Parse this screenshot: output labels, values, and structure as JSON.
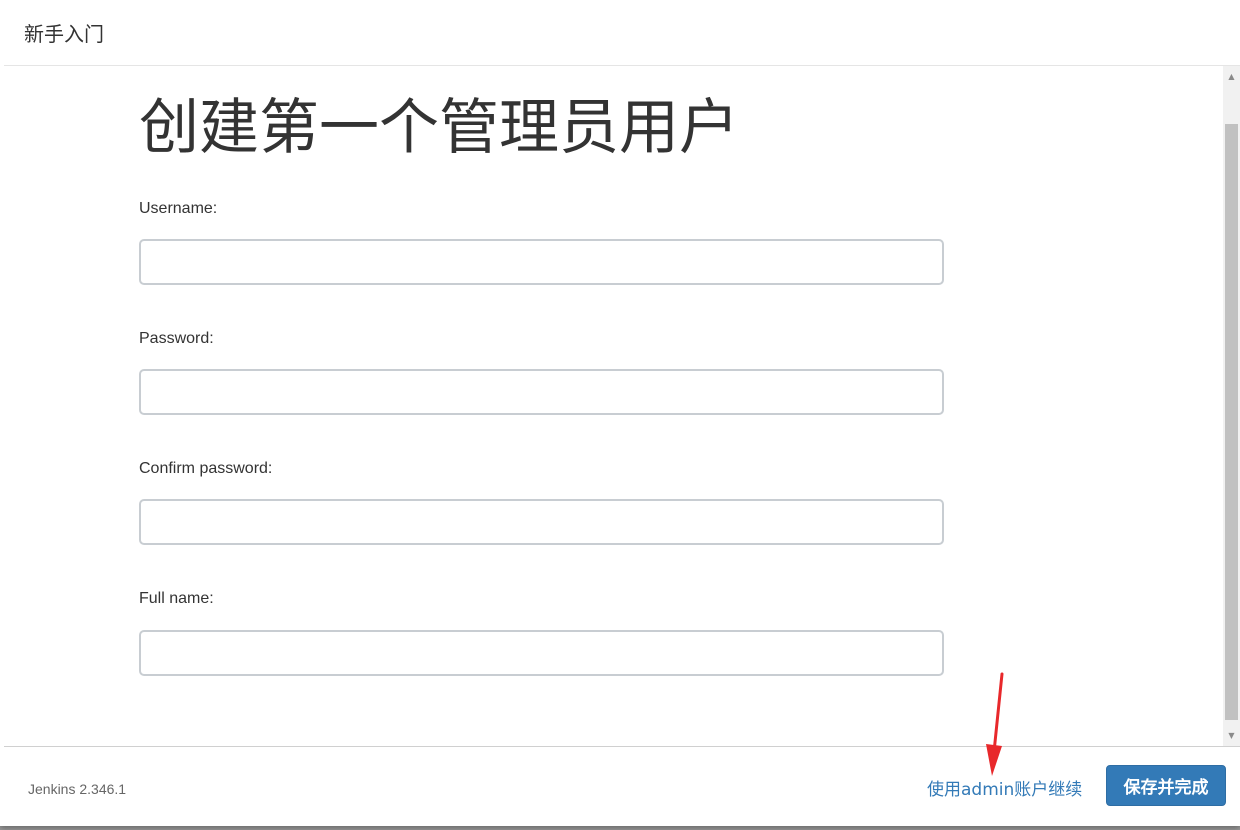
{
  "header": {
    "title": "新手入门"
  },
  "main": {
    "title": "创建第一个管理员用户",
    "fields": [
      {
        "label": "Username:",
        "value": ""
      },
      {
        "label": "Password:",
        "value": ""
      },
      {
        "label": "Confirm password:",
        "value": ""
      },
      {
        "label": "Full name:",
        "value": ""
      }
    ]
  },
  "footer": {
    "version": "Jenkins 2.346.1",
    "continue_link": "使用admin账户继续",
    "save_button": "保存并完成"
  },
  "colors": {
    "primary": "#337ab7",
    "annotation": "#e8282b"
  },
  "icons": {
    "scroll_up": "triangle-up-icon",
    "scroll_down": "triangle-down-icon",
    "annotation": "red-arrow-icon"
  }
}
